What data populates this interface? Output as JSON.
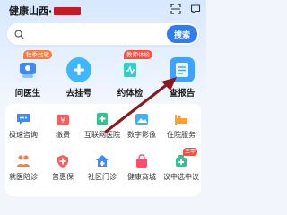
{
  "header": {
    "title": "健康山西·",
    "icons": [
      "scan-icon",
      "message-icon"
    ]
  },
  "search": {
    "button_label": "搜索"
  },
  "quick_actions": [
    {
      "label": "问医生",
      "tag": "秋季过敏",
      "icon": "doctor-icon",
      "color": "#e9f1ff"
    },
    {
      "label": "去挂号",
      "tag": "",
      "icon": "plus-icon",
      "color": "#3fb7ff"
    },
    {
      "label": "约体检",
      "tag": "教师体检",
      "icon": "checkup-icon",
      "color": "#e3f6ff"
    },
    {
      "label": "查报告",
      "tag": "",
      "icon": "report-icon",
      "color": "#3da3ff"
    }
  ],
  "services_row1": [
    {
      "label": "极速咨询",
      "icon": "chat-icon"
    },
    {
      "label": "缴费",
      "icon": "payment-icon"
    },
    {
      "label": "互联网医院",
      "icon": "hospital-icon"
    },
    {
      "label": "数字影像",
      "icon": "image-icon"
    },
    {
      "label": "住院服务",
      "icon": "inpatient-icon"
    }
  ],
  "services_row2": [
    {
      "label": "就医陪诊",
      "icon": "escort-icon",
      "tag": ""
    },
    {
      "label": "普惠保",
      "icon": "insurance-icon",
      "tag": ""
    },
    {
      "label": "社区门诊",
      "icon": "community-icon",
      "tag": ""
    },
    {
      "label": "健康商城",
      "icon": "mall-icon",
      "tag": ""
    },
    {
      "label": "议中选中议",
      "icon": "medicine-icon",
      "tag": "三甲"
    }
  ],
  "colors": {
    "brand_blue": "#2f7cf6",
    "tag_red": "#ff4d3d",
    "tag_orange": "#ff7a3d",
    "arrow": "#8b1a1f"
  }
}
